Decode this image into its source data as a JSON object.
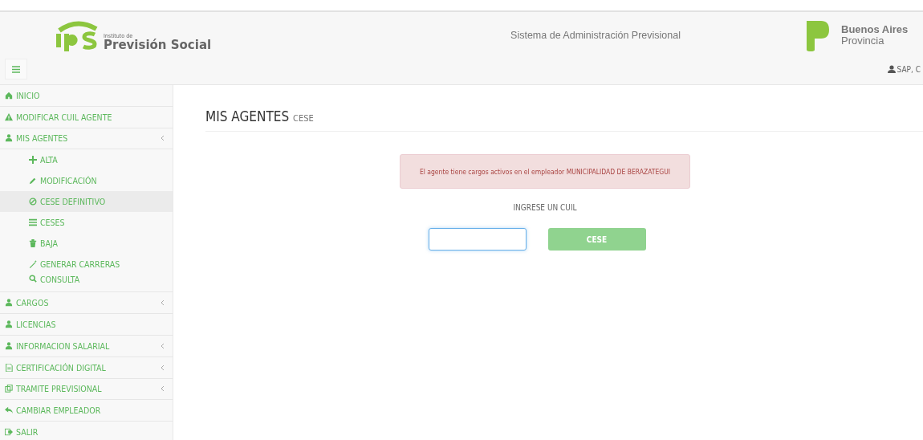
{
  "header": {
    "logo_small": "Instituto de",
    "logo_name": "Previsión Social",
    "system_title": "Sistema de Administración Previsional",
    "province_name": "Buenos Aires",
    "province_sub": "Provincia",
    "user": "SAP, C"
  },
  "sidebar": {
    "items": [
      {
        "label": "INICIO",
        "selected": false,
        "expandable": false
      },
      {
        "label": "MODIFICAR CUIL AGENTE",
        "selected": false,
        "expandable": false
      },
      {
        "label": "MIS AGENTES",
        "selected": false,
        "expandable": true,
        "children": [
          {
            "label": "ALTA",
            "selected": false
          },
          {
            "label": "MODIFICACIÓN",
            "selected": false
          },
          {
            "label": "CESE DEFINITIVO",
            "selected": true
          },
          {
            "label": "CESES",
            "selected": false
          },
          {
            "label": "BAJA",
            "selected": false
          },
          {
            "label": "GENERAR CARRERAS",
            "selected": false
          },
          {
            "label": "CONSULTA",
            "selected": false
          }
        ]
      },
      {
        "label": "CARGOS",
        "selected": false,
        "expandable": true
      },
      {
        "label": "LICENCIAS",
        "selected": false,
        "expandable": false
      },
      {
        "label": "INFORMACION SALARIAL",
        "selected": false,
        "expandable": true
      },
      {
        "label": "CERTIFICACIÓN DIGITAL",
        "selected": false,
        "expandable": true
      },
      {
        "label": "TRAMITE PREVISIONAL",
        "selected": false,
        "expandable": true
      },
      {
        "label": "CAMBIAR EMPLEADOR",
        "selected": false,
        "expandable": false
      },
      {
        "label": "SALIR",
        "selected": false,
        "expandable": false
      }
    ]
  },
  "page": {
    "title": "MIS AGENTES",
    "subtitle": "CESE",
    "alert": "El agente tiene cargos activos en el empleador MUNICIPALIDAD DE BERAZATEGUI",
    "prompt": "INGRESE UN CUIL",
    "submit": {
      "label": "CESE",
      "disabled": true
    }
  }
}
